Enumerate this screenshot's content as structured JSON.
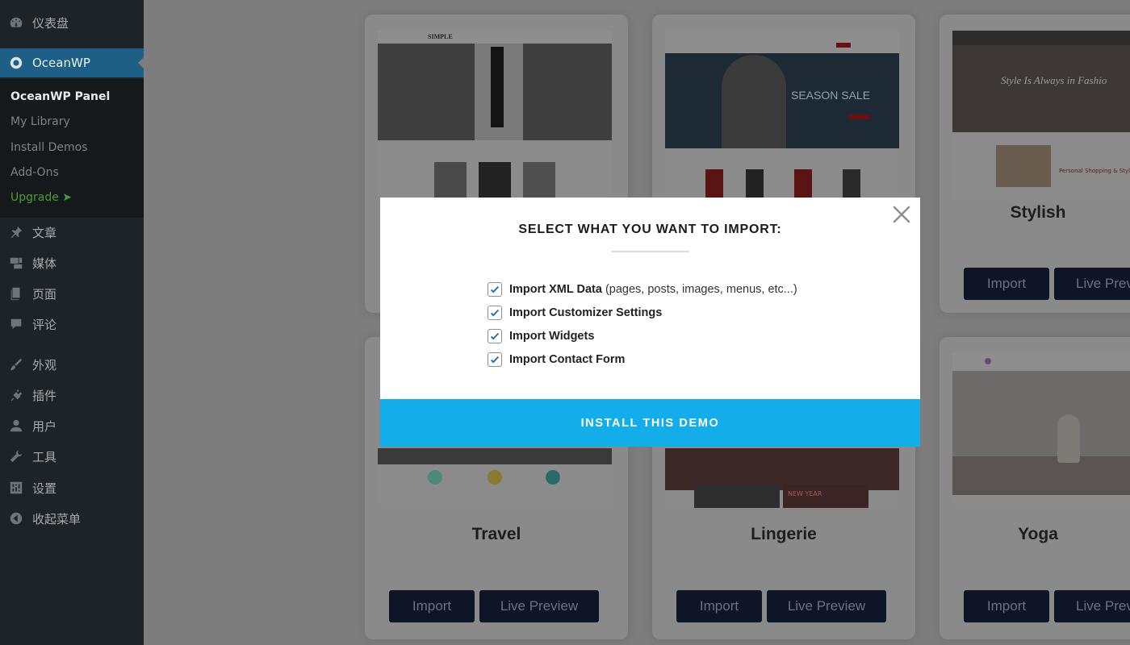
{
  "sidebar": {
    "dashboard": "仪表盘",
    "oceanwp": "OceanWP",
    "submenu": [
      "OceanWP Panel",
      "My Library",
      "Install Demos",
      "Add-Ons",
      "Upgrade ➤"
    ],
    "items": [
      "文章",
      "媒体",
      "页面",
      "评论",
      "外观",
      "插件",
      "用户",
      "工具",
      "设置",
      "收起菜单"
    ]
  },
  "cards": {
    "top_right_title": "Stylish",
    "bottom": [
      {
        "title": "Travel",
        "import": "Import",
        "preview": "Live Preview"
      },
      {
        "title": "Lingerie",
        "import": "Import",
        "preview": "Live Preview"
      },
      {
        "title": "Yoga",
        "import": "Import",
        "preview": "Live Prev"
      }
    ],
    "top_right_buttons": {
      "import": "Import",
      "preview": "Live Prev"
    },
    "thumb_texts": {
      "simple_logo": "SIMPLE",
      "season_sale": "SEASON SALE",
      "stylish_tagline": "Style Is Always in Fashio",
      "stylish_sub": "Personal Shopping & Stylin",
      "new_year": "NEW YEAR"
    }
  },
  "modal": {
    "title": "SELECT WHAT YOU WANT TO IMPORT:",
    "options": [
      {
        "label": "Import XML Data",
        "note": "(pages, posts, images, menus, etc...)",
        "checked": true
      },
      {
        "label": "Import Customizer Settings",
        "note": "",
        "checked": true
      },
      {
        "label": "Import Widgets",
        "note": "",
        "checked": true
      },
      {
        "label": "Import Contact Form",
        "note": "",
        "checked": true
      }
    ],
    "install_button": "INSTALL THIS DEMO"
  },
  "colors": {
    "sidebar_bg": "#1d2327",
    "active_menu": "#1e5f86",
    "install_button": "#13aeea",
    "dark_button": "#0d1527",
    "upgrade_green": "#4a9c35"
  }
}
